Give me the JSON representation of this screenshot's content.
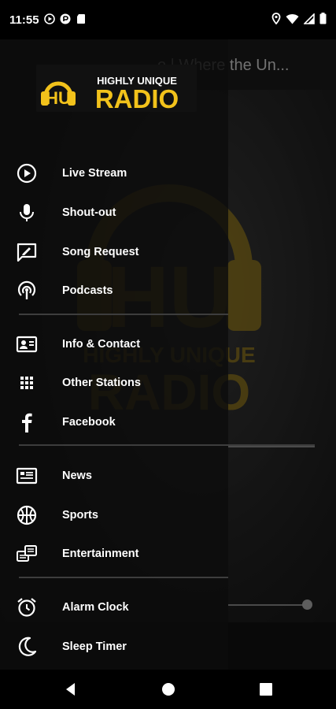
{
  "status_bar": {
    "time": "11:55",
    "left_icons": [
      "play-circle-icon",
      "media-icon",
      "sd-card-icon"
    ],
    "right_icons": [
      "location-icon",
      "wifi-icon",
      "signal-icon",
      "battery-icon"
    ]
  },
  "app": {
    "title": "o | Where the Un..."
  },
  "drawer": {
    "logo": {
      "top_text": "HIGHLY UNIQUE",
      "bottom_text": "RADIO",
      "mark": "HU"
    },
    "groups": [
      [
        {
          "label": "Live Stream",
          "icon": "play-circle-icon"
        },
        {
          "label": "Shout-out",
          "icon": "microphone-icon"
        },
        {
          "label": "Song Request",
          "icon": "song-request-icon"
        },
        {
          "label": "Podcasts",
          "icon": "podcast-icon"
        }
      ],
      [
        {
          "label": "Info & Contact",
          "icon": "contact-card-icon"
        },
        {
          "label": "Other Stations",
          "icon": "grid-icon"
        },
        {
          "label": "Facebook",
          "icon": "facebook-icon"
        }
      ],
      [
        {
          "label": "News",
          "icon": "news-icon"
        },
        {
          "label": "Sports",
          "icon": "basketball-icon"
        },
        {
          "label": "Entertainment",
          "icon": "entertainment-icon"
        }
      ],
      [
        {
          "label": "Alarm Clock",
          "icon": "alarm-clock-icon"
        },
        {
          "label": "Sleep Timer",
          "icon": "moon-icon"
        }
      ]
    ]
  },
  "colors": {
    "brand_yellow": "#F2C21B",
    "drawer_bg": "#0c0c0c",
    "text": "#ffffff"
  }
}
